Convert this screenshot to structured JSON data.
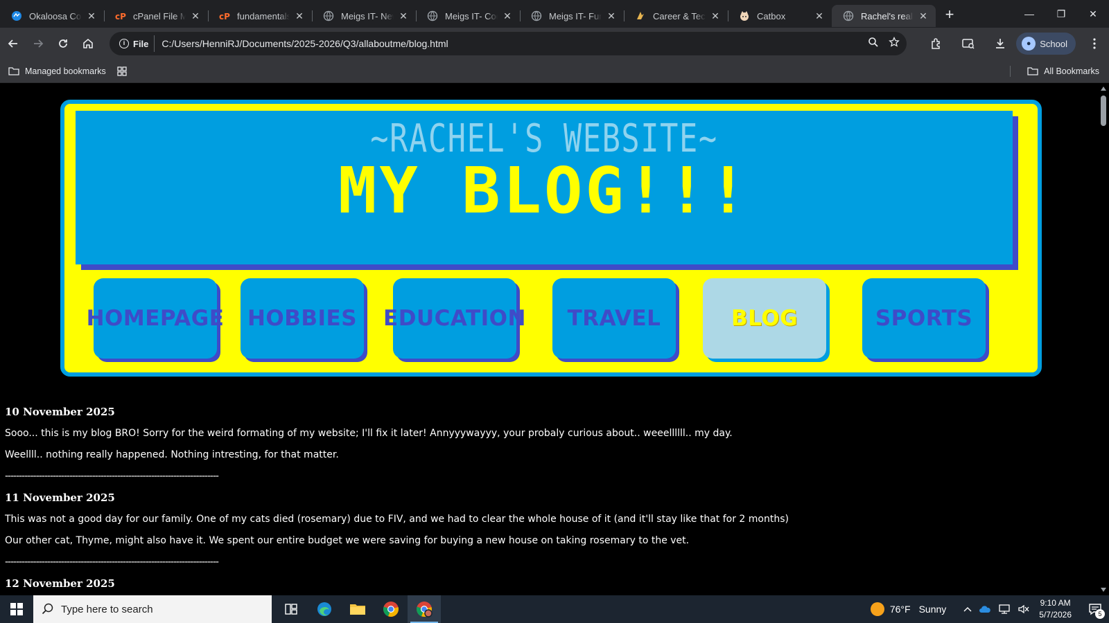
{
  "browser": {
    "tabs": [
      {
        "label": "Okaloosa County",
        "icon": "blue-circle-icon",
        "active": false
      },
      {
        "label": "cPanel File Manager",
        "icon": "cpanel-icon",
        "active": false
      },
      {
        "label": "fundamentals.html",
        "icon": "cpanel-icon",
        "active": false
      },
      {
        "label": "Meigs IT- New",
        "icon": "globe-icon",
        "active": false
      },
      {
        "label": "Meigs IT- Coding",
        "icon": "globe-icon",
        "active": false
      },
      {
        "label": "Meigs IT- Fundamentals",
        "icon": "globe-icon",
        "active": false
      },
      {
        "label": "Career & Technical",
        "icon": "career-icon",
        "active": false
      },
      {
        "label": "Catbox",
        "icon": "catbox-icon",
        "active": false
      },
      {
        "label": "Rachel's really cool",
        "icon": "globe-icon",
        "active": true
      }
    ],
    "address": {
      "chip": "File",
      "url": "C:/Users/HenniRJ/Documents/2025-2026/Q3/allaboutme/blog.html"
    },
    "profile": "School",
    "bookmarks": {
      "managed": "Managed bookmarks",
      "all": "All Bookmarks"
    }
  },
  "page": {
    "site_title": "~RACHEL'S WEBSITE~",
    "heading": "MY BLOG!!!",
    "nav": [
      {
        "label": "HOMEPAGE",
        "active": false
      },
      {
        "label": "HOBBIES",
        "active": false
      },
      {
        "label": "EDUCATION",
        "active": false
      },
      {
        "label": "TRAVEL",
        "active": false
      },
      {
        "label": "BLOG",
        "active": true
      },
      {
        "label": "SPORTS",
        "active": false
      }
    ],
    "colors": {
      "banner_yellow": "#ffff00",
      "header_blue": "#009ee0",
      "shadow_indigo": "#3f4bc8",
      "active_tab": "#add8e6"
    },
    "entries": [
      {
        "date": "10 November 2025",
        "lines": [
          "Sooo... this is my blog BRO! Sorry for the weird formating of my website; I'll fix it later! Annyyywayyy, your probaly curious about.. weeellllll.. my day.",
          "Weellll.. nothing really happened. Nothing intresting, for that matter."
        ]
      },
      {
        "date": "11 November 2025",
        "lines": [
          "This was not a good day for our family. One of my cats died (rosemary) due to FIV, and we had to clear the whole house of it (and it'll stay like that for 2 months)",
          "Our other cat, Thyme, might also have it. We spent our entire budget we were saving for buying a new house on taking rosemary to the vet."
        ]
      },
      {
        "date": "12 November 2025",
        "lines": []
      }
    ],
    "divider": "----------------------------------------------------------------------------"
  },
  "taskbar": {
    "search_placeholder": "Type here to search",
    "weather": {
      "temp": "76°F",
      "condition": "Sunny"
    },
    "time": "9:10 AM",
    "date": "5/7/2026",
    "notification_count": "5"
  }
}
